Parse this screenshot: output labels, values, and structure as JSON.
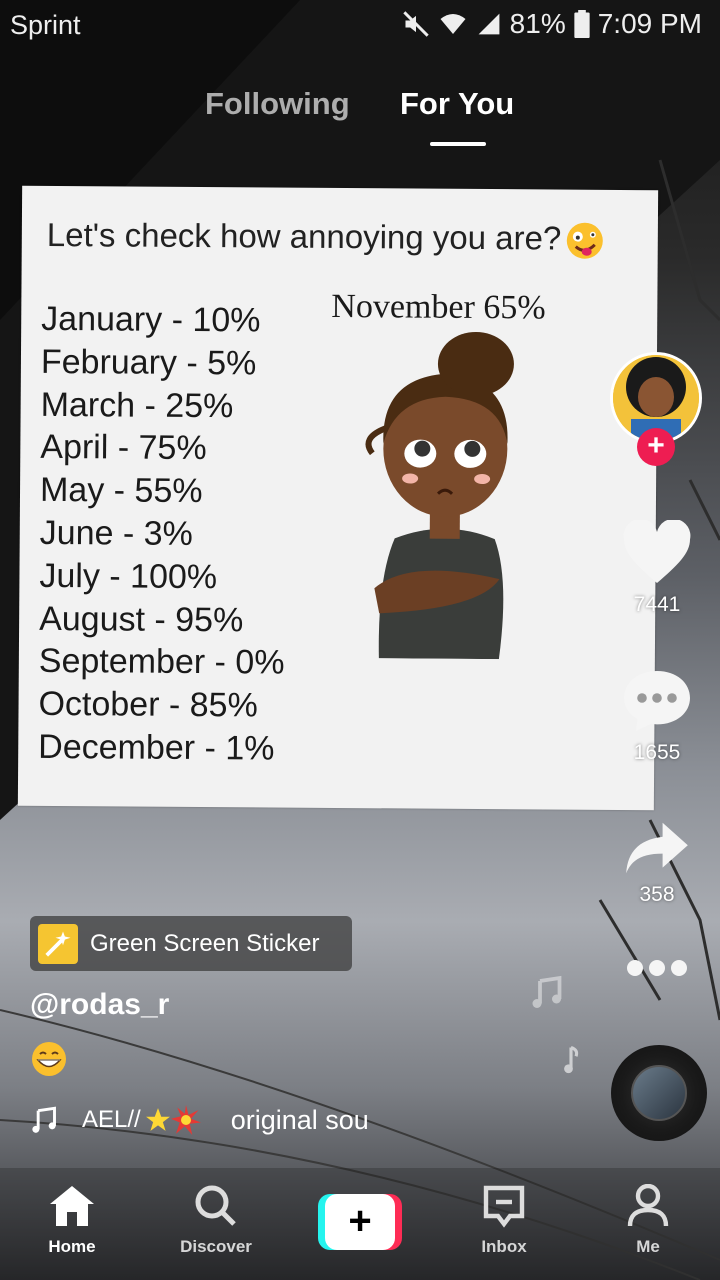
{
  "status_bar": {
    "carrier": "Sprint",
    "battery": "81%",
    "time": "7:09 PM"
  },
  "feed_tabs": {
    "following": "Following",
    "for_you": "For You",
    "active": "For You"
  },
  "card": {
    "title": "Let's check how annoying you are?",
    "highlight": "November 65%",
    "months": [
      "January  - 10%",
      "February - 5%",
      "March  - 25%",
      "April  - 75%",
      "May - 55%",
      "June - 3%",
      "July - 100%",
      "August - 95%",
      "September - 0%",
      "October - 85%",
      "December - 1%"
    ]
  },
  "actions": {
    "likes": "7441",
    "comments": "1655",
    "shares": "358"
  },
  "video_info": {
    "sticker_label": "Green Screen Sticker",
    "username": "@rodas_r",
    "music_artist": "AEL//",
    "music_title": "original sou"
  },
  "bottom_nav": {
    "home": "Home",
    "discover": "Discover",
    "inbox": "Inbox",
    "me": "Me"
  },
  "colors": {
    "brand_red": "#fe2c55",
    "brand_cyan": "#25f4ee",
    "follow_plus": "#ee1d52",
    "sticker_icon": "#f5c531"
  },
  "icons": [
    "mute-icon",
    "wifi-icon",
    "signal-icon",
    "battery-icon",
    "heart-icon",
    "comment-icon",
    "share-icon",
    "more-icon",
    "music-note-icon",
    "home-icon",
    "search-icon",
    "plus-icon",
    "inbox-icon",
    "profile-icon",
    "sticker-wand-icon"
  ]
}
